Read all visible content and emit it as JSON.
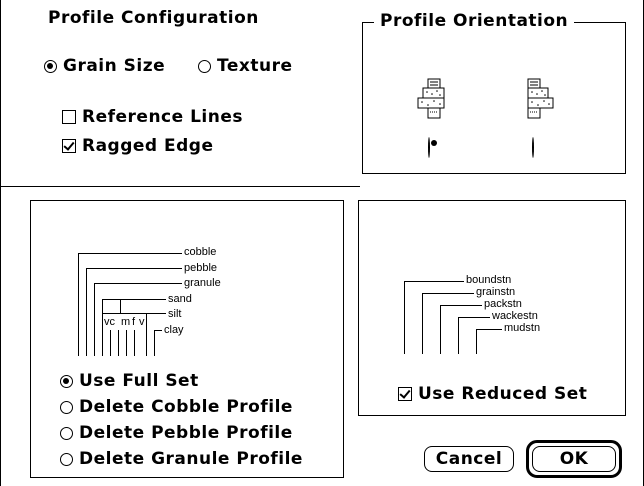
{
  "profile_config": {
    "title": "Profile Configuration",
    "grain_size_label": "Grain Size",
    "grain_size_selected": true,
    "texture_label": "Texture",
    "texture_selected": false,
    "reference_lines_label": "Reference Lines",
    "reference_lines_checked": false,
    "ragged_edge_label": "Ragged Edge",
    "ragged_edge_checked": true
  },
  "orientation": {
    "title": "Profile Orientation",
    "option1_selected": true,
    "option2_selected": false
  },
  "full_set": {
    "diagram": {
      "cobble": "cobble",
      "pebble": "pebble",
      "granule": "granule",
      "sand": "sand",
      "silt": "silt",
      "clay": "clay",
      "sub_vc": "vc",
      "sub_m": "m",
      "sub_f": "f",
      "sub_v": "v"
    },
    "options": [
      {
        "label": "Use Full Set",
        "selected": true
      },
      {
        "label": "Delete Cobble Profile",
        "selected": false
      },
      {
        "label": "Delete Pebble Profile",
        "selected": false
      },
      {
        "label": "Delete Granule  Profile",
        "selected": false
      }
    ]
  },
  "reduced_set": {
    "diagram": {
      "boundstn": "boundstn",
      "grainstn": "grainstn",
      "packstn": "packstn",
      "wackestn": "wackestn",
      "mudstn": "mudstn"
    },
    "label": "Use Reduced Set",
    "checked": true
  },
  "buttons": {
    "cancel": "Cancel",
    "ok": "OK"
  },
  "colors": {
    "foreground": "#000000",
    "background": "#ffffff"
  }
}
